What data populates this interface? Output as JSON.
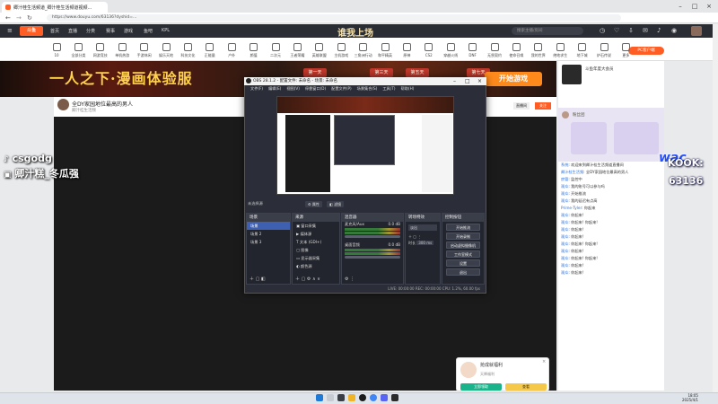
{
  "browser": {
    "tab_title": "卿汁桂生活频道_卿汁桂生活频道视频...",
    "url": "https://www.douyu.com/63136?dyshid=..."
  },
  "site": {
    "logo": "斗鱼",
    "nav": [
      "首页",
      "直播",
      "分类",
      "赛事",
      "游戏",
      "鱼吧",
      "KPL"
    ],
    "search_placeholder": "搜索主播/房间",
    "header_banner": "谁我上场",
    "categories": [
      "10",
      "全部分类",
      "网游竞技",
      "单机热游",
      "手游休闲",
      "娱乐天地",
      "科技文化",
      "正能量",
      "户外",
      "颜值",
      "二次元",
      "王者荣耀",
      "英雄联盟",
      "主机游戏",
      "三角洲行动",
      "和平精英",
      "原神",
      "CS2",
      "穿越火线",
      "DNF",
      "无畏契约",
      "使命召唤",
      "我的世界",
      "绝地求生",
      "地下城",
      "炉石传说",
      "更多"
    ],
    "pc_client": "PC客户端",
    "banner_title": "一人之下·漫画体验服",
    "banner_days": [
      "第一天",
      "第三天",
      "第五天",
      "第七天"
    ],
    "start_game": "开始游戏",
    "right_ad": "斗鱼年度大会员",
    "room_title": "全DY家园地位最高的男人",
    "room_tag": "卿汁桂生活频",
    "room_btn1": "直播间",
    "room_btn2": "关注"
  },
  "overlay": {
    "line1": "csgodg",
    "line2": "卿汁糕_冬瓜强",
    "kook": "KOOK:",
    "kook_id": "63136",
    "wac": "wac"
  },
  "obs": {
    "title": "OBS 28.1.2 - 配置文件: 未命名 - 场景: 未命名",
    "menu": [
      "文件(F)",
      "编辑(E)",
      "视图(V)",
      "停靠窗口(D)",
      "配置文件(P)",
      "场景集合(S)",
      "工具(T)",
      "帮助(H)"
    ],
    "source_bar": "未选择源",
    "btn_props": "属性",
    "btn_filters": "滤镜",
    "panels": {
      "scenes": "场景",
      "sources": "来源",
      "mixer": "混音器",
      "transitions": "转场特效",
      "controls": "控制按钮"
    },
    "scenes": [
      "场景",
      "场景 2",
      "场景 3"
    ],
    "sources": [
      "窗口采集",
      "媒体源",
      "文本 (GDI+)",
      "图像",
      "显示器采集",
      "颜色源"
    ],
    "mixer": [
      {
        "name": "麦克风/Aux",
        "db": "0.0 dB"
      },
      {
        "name": "桌面音频",
        "db": "0.0 dB"
      }
    ],
    "transition": "淡出",
    "duration_label": "时长",
    "duration": "300 ms",
    "controls": [
      "开始推流",
      "开始录制",
      "启动虚拟摄像机",
      "工作室模式",
      "设置",
      "退出"
    ],
    "status": "LIVE: 00:00:00   REC: 00:00:00   CPU: 1.2%, 60.00 fps"
  },
  "chat": {
    "header": "粉丝团",
    "messages": [
      {
        "user": "系统",
        "text": "欢迎来到卿汁桂生活频道直播间"
      },
      {
        "user": "卿汁桂生活频",
        "text": "全DY家园地位最高的男人"
      },
      {
        "user": "房管",
        "text": "监控中"
      },
      {
        "user": "观众",
        "text": "我的账号可以参与吗"
      },
      {
        "user": "观众",
        "text": "开始推流"
      },
      {
        "user": "观众",
        "text": "我的延迟有点高"
      },
      {
        "user": "Prime·Tyler",
        "text": "你起来"
      },
      {
        "user": "观众",
        "text": "你起来!"
      },
      {
        "user": "观众",
        "text": "你起来! 你起来!"
      },
      {
        "user": "观众",
        "text": "你起来!"
      },
      {
        "user": "观众",
        "text": "你起来!"
      },
      {
        "user": "观众",
        "text": "你起来! 你起来!"
      },
      {
        "user": "观众",
        "text": "你起来!"
      },
      {
        "user": "观众",
        "text": "你起来! 你起来!"
      },
      {
        "user": "观众",
        "text": "你起来!"
      },
      {
        "user": "观众",
        "text": "你起来!"
      }
    ]
  },
  "popup": {
    "title": "抢成就福利",
    "subtitle": "天降福利",
    "btn1": "立即领取",
    "btn2": "查看"
  },
  "taskbar": {
    "time": "18:05",
    "date": "2025/4/1"
  }
}
